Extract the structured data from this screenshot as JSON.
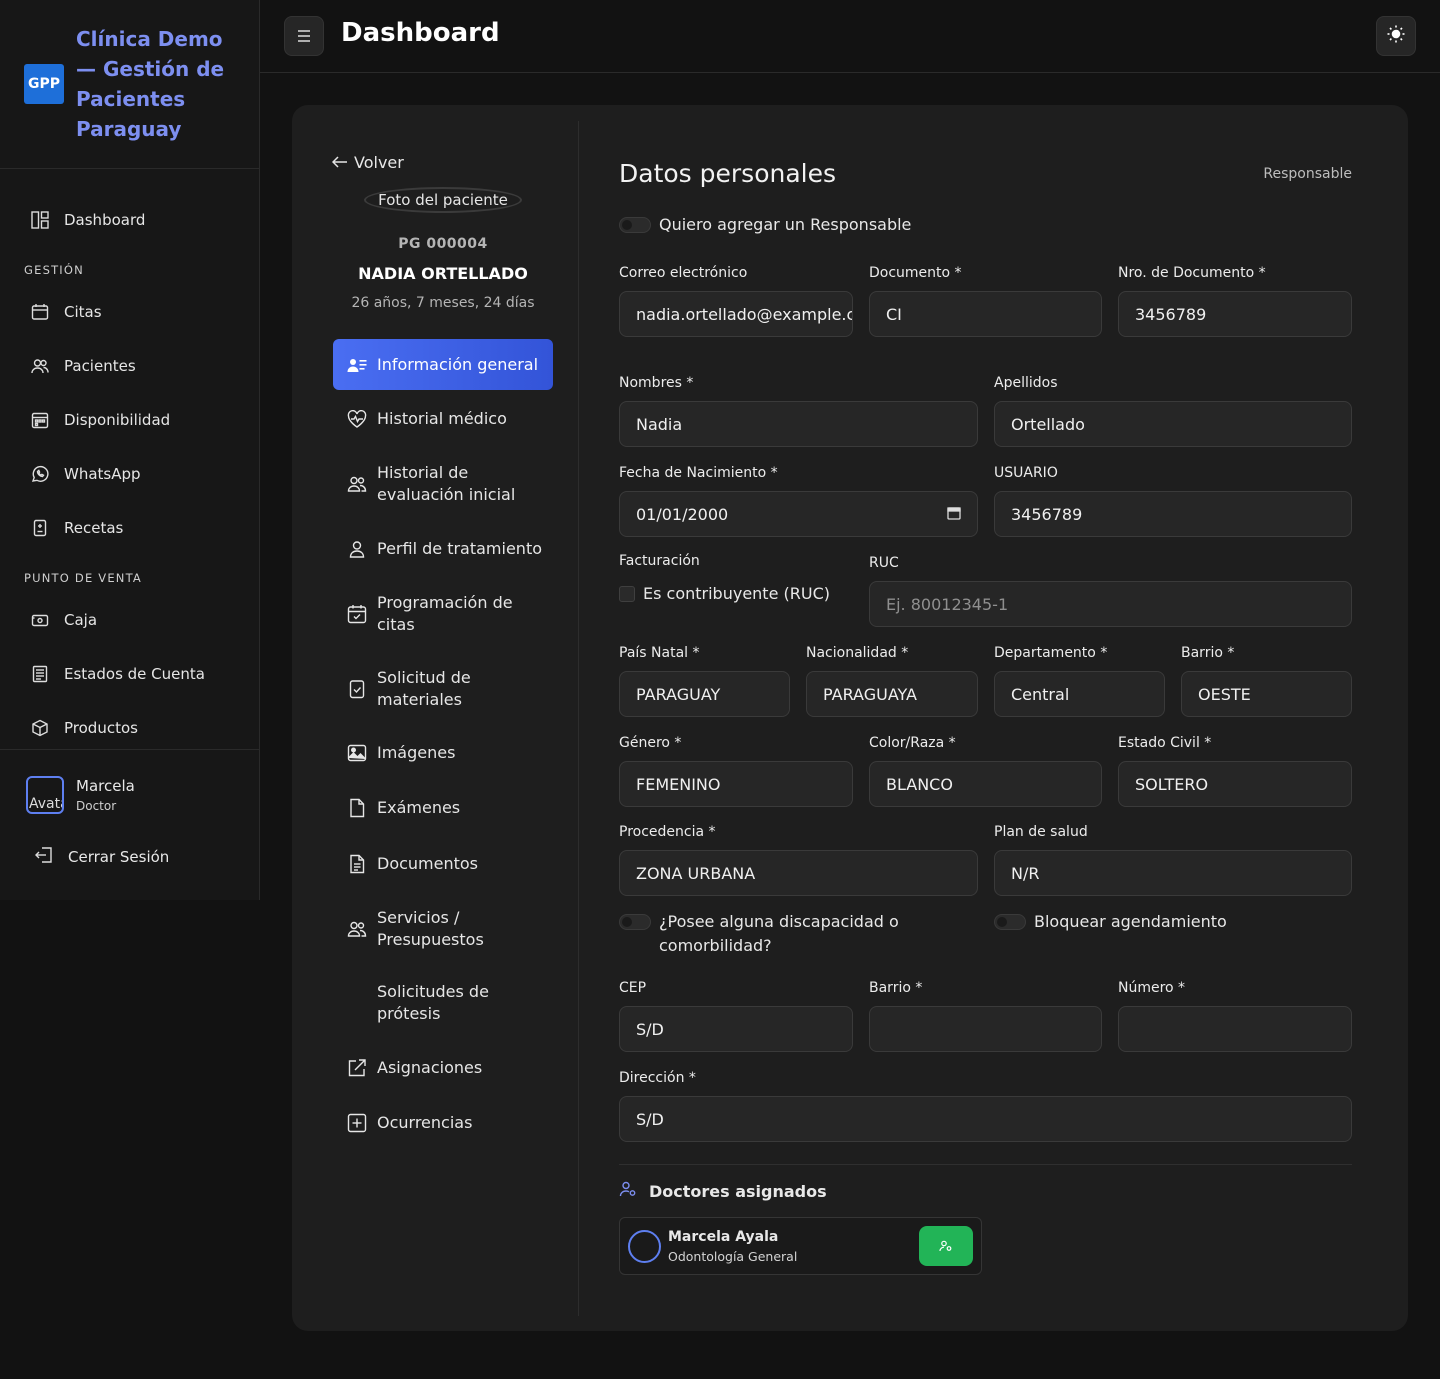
{
  "brand": {
    "logo": "GPP",
    "title": "Clínica Demo — Gestión de Pacientes Paraguay"
  },
  "sidebar": {
    "dashboard": "Dashboard",
    "section_gestion": "GESTIÓN",
    "gestion_items": [
      "Citas",
      "Pacientes",
      "Disponibilidad",
      "WhatsApp",
      "Recetas"
    ],
    "section_pos": "PUNTO DE VENTA",
    "pos_items": [
      "Caja",
      "Estados de Cuenta",
      "Productos"
    ],
    "user": {
      "avatar_alt": "Avatar",
      "name": "Marcela",
      "role": "Doctor"
    },
    "logout": "Cerrar Sesión"
  },
  "topbar": {
    "title": "Dashboard"
  },
  "patient": {
    "back": "Volver",
    "photo_alt": "Foto del paciente",
    "id": "PG 000004",
    "name": "NADIA ORTELLADO",
    "age": "26 años, 7 meses, 24 días"
  },
  "patient_menu": [
    "Información general",
    "Historial médico",
    "Historial de evaluación inicial",
    "Perfil de tratamiento",
    "Programación de citas",
    "Solicitud de materiales",
    "Imágenes",
    "Exámenes",
    "Documentos",
    "Servicios / Presupuestos",
    "Solicitudes de prótesis",
    "Asignaciones",
    "Ocurrencias"
  ],
  "form": {
    "title": "Datos personales",
    "responsable_tab": "Responsable",
    "add_responsable": "Quiero agregar un Responsable",
    "email": {
      "label": "Correo electrónico",
      "value": "nadia.ortellado@example.com"
    },
    "documento": {
      "label": "Documento *",
      "value": "CI"
    },
    "nro_documento": {
      "label": "Nro. de Documento *",
      "value": "3456789"
    },
    "nombres": {
      "label": "Nombres *",
      "value": "Nadia"
    },
    "apellidos": {
      "label": "Apellidos",
      "value": "Ortellado"
    },
    "fecha_nacimiento": {
      "label": "Fecha de Nacimiento *",
      "value": "01/01/2000"
    },
    "usuario": {
      "label": "USUARIO",
      "value": "3456789"
    },
    "facturacion": {
      "label": "Facturación",
      "checkbox": "Es contribuyente (RUC)"
    },
    "ruc": {
      "label": "RUC",
      "placeholder": "Ej. 80012345-1"
    },
    "pais_natal": {
      "label": "País Natal *",
      "value": "PARAGUAY"
    },
    "nacionalidad": {
      "label": "Nacionalidad *",
      "value": "PARAGUAYA"
    },
    "departamento": {
      "label": "Departamento *",
      "value": "Central"
    },
    "barrio_top": {
      "label": "Barrio *",
      "value": "OESTE"
    },
    "genero": {
      "label": "Género *",
      "value": "FEMENINO"
    },
    "color_raza": {
      "label": "Color/Raza *",
      "value": "BLANCO"
    },
    "estado_civil": {
      "label": "Estado Civil *",
      "value": "SOLTERO"
    },
    "procedencia": {
      "label": "Procedencia *",
      "value": "ZONA URBANA"
    },
    "plan_salud": {
      "label": "Plan de salud",
      "value": "N/R"
    },
    "discapacidad": "¿Posee alguna discapacidad o comorbilidad?",
    "bloquear": "Bloquear agendamiento",
    "cep": {
      "label": "CEP",
      "value": "S/D"
    },
    "barrio": {
      "label": "Barrio *",
      "value": ""
    },
    "numero": {
      "label": "Número *",
      "value": ""
    },
    "direccion": {
      "label": "Dirección *",
      "value": "S/D"
    }
  },
  "doctors": {
    "title": "Doctores asignados",
    "items": [
      {
        "name": "Marcela Ayala",
        "specialty": "Odontología General"
      }
    ]
  },
  "colors": {
    "accent": "#4a6ef2",
    "brand": "#7d8ff0",
    "success": "#22b457"
  }
}
